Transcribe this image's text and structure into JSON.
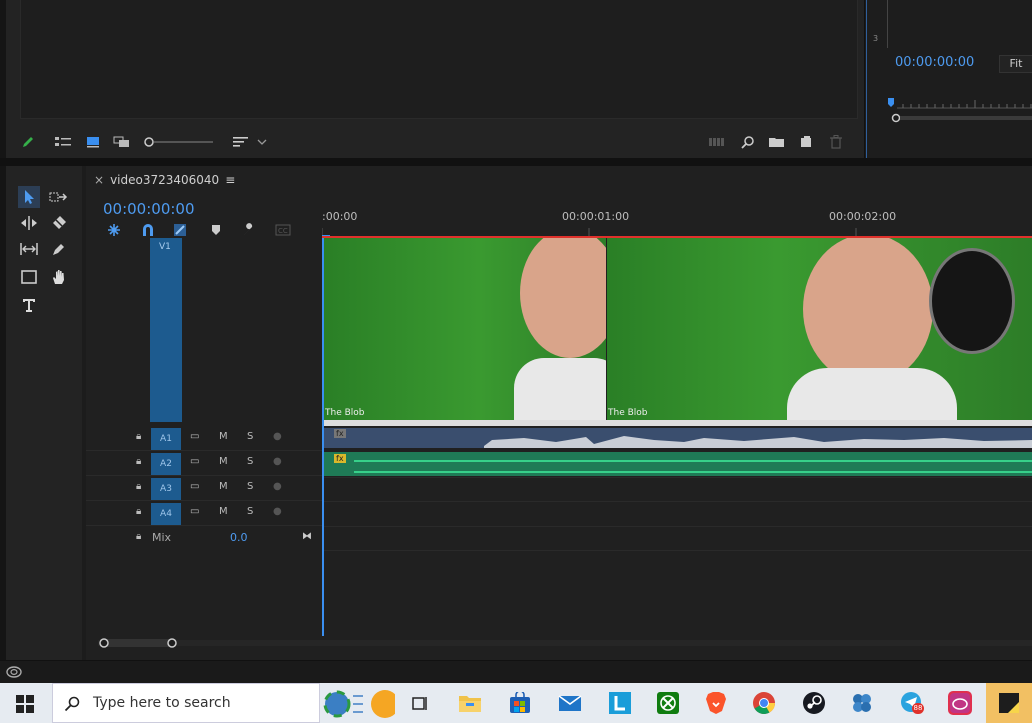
{
  "program_monitor": {
    "timecode": "00:00:00:00",
    "zoom_label": "Fit",
    "ruler_number": "3"
  },
  "timeline": {
    "sequence_name": "video3723406040",
    "tab_close": "×",
    "tab_menu": "≡",
    "playhead_timecode": "00:00:00:00",
    "ruler_labels": [
      ":00:00",
      "00:00:01:00",
      "00:00:02:00"
    ],
    "video_tracks": [
      {
        "name": "V1",
        "clips": [
          {
            "label": "The Blob"
          },
          {
            "label": "The Blob"
          }
        ]
      }
    ],
    "audio_tracks": [
      {
        "name": "A1",
        "mute": "M",
        "solo": "S",
        "fx": "fx"
      },
      {
        "name": "A2",
        "mute": "M",
        "solo": "S",
        "fx": "fx"
      },
      {
        "name": "A3",
        "mute": "M",
        "solo": "S"
      },
      {
        "name": "A4",
        "mute": "M",
        "solo": "S"
      }
    ],
    "mix": {
      "label": "Mix",
      "value": "0.0"
    }
  },
  "taskbar": {
    "search_placeholder": "Type here to search",
    "telegram_badge": "88"
  },
  "colors": {
    "accent_blue": "#4e9bf0",
    "track_target": "#1d5b8f",
    "audio_clip_a1": "#3a4e6e",
    "audio_clip_a2": "#1f7a56",
    "playhead": "#e0312b",
    "green_screen": "#2f8a2a"
  }
}
